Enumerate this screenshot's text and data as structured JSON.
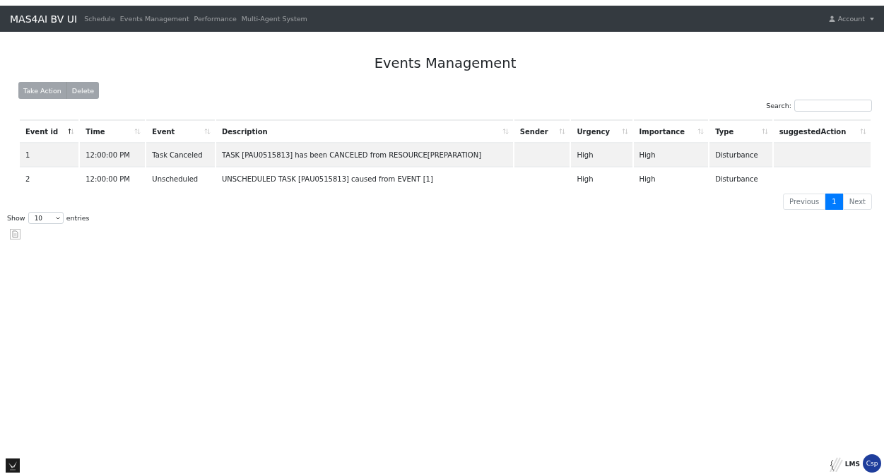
{
  "navbar": {
    "brand": "MAS4AI BV UI",
    "links": [
      {
        "label": "Schedule",
        "selected": false
      },
      {
        "label": "Events Management",
        "selected": false
      },
      {
        "label": "Performance",
        "selected": false
      },
      {
        "label": "Multi-Agent System",
        "selected": false
      }
    ],
    "account": "Account"
  },
  "title": "Events Management",
  "actions": [
    {
      "label": "Take Action",
      "disabled": true
    },
    {
      "label": "Delete",
      "disabled": true
    }
  ],
  "search": {
    "label": "Search:"
  },
  "table": {
    "columns": [
      {
        "label": "Event id",
        "sorted": true
      },
      {
        "label": "Time",
        "sorted": false
      },
      {
        "label": "Event",
        "sorted": false
      },
      {
        "label": "Description",
        "sorted": false
      },
      {
        "label": "Sender",
        "sorted": false
      },
      {
        "label": "Urgency",
        "sorted": false
      },
      {
        "label": "Importance",
        "sorted": false
      },
      {
        "label": "Type",
        "sorted": false
      },
      {
        "label": "suggestedAction",
        "sorted": false
      }
    ],
    "rows": [
      {
        "cells": [
          "1",
          "12:00:00 PM",
          "Task Canceled",
          "TASK [PAU0515813] has been CANCELED from RESOURCE[PREPARATION]",
          "",
          "High",
          "High",
          "Disturbance",
          ""
        ]
      },
      {
        "cells": [
          "2",
          "12:00:00 PM",
          "Unscheduled",
          "UNSCHEDULED TASK [PAU0515813] caused from EVENT [1]",
          "",
          "High",
          "High",
          "Disturbance",
          ""
        ]
      }
    ]
  },
  "pagination": [
    {
      "label": "Previous",
      "selected": false
    },
    {
      "label": "1",
      "selected": true
    },
    {
      "label": "Next",
      "selected": false
    }
  ],
  "length": {
    "before": "Show",
    "value": "10",
    "after": "entries"
  },
  "footer": {
    "logos": [
      "LMS",
      "Csp"
    ]
  }
}
